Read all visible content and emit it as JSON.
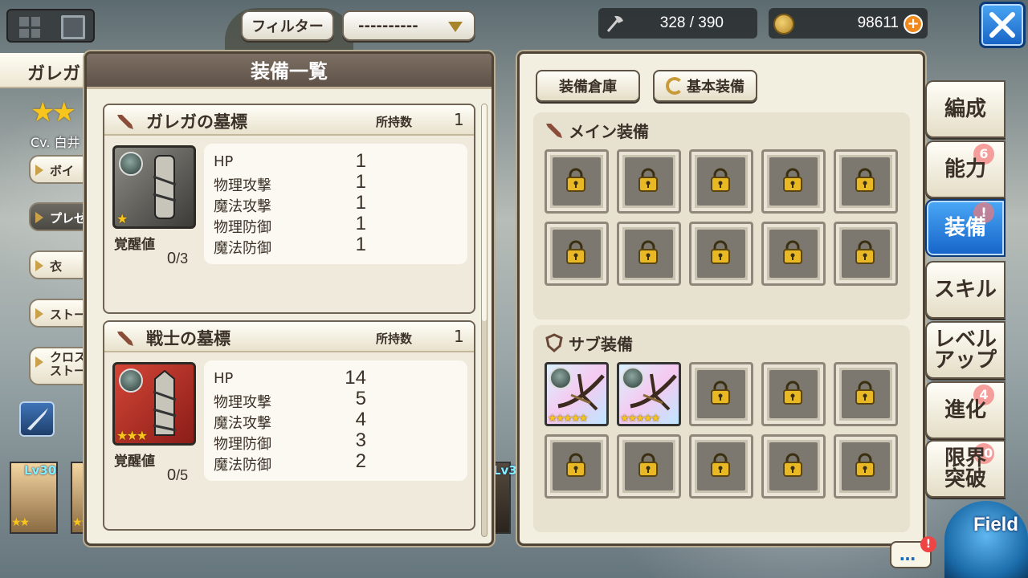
{
  "topbar": {
    "filter_label": "フィルター",
    "select_value": "----------",
    "stamina": "328 / 390",
    "currency": "98611"
  },
  "character": {
    "name": "ガレガ",
    "cv": "Cv. 白井",
    "tabs": [
      "ボイ",
      "プレゼ",
      "衣",
      "ストー",
      "クロス\nストー"
    ]
  },
  "party": [
    {
      "level": "Lv30",
      "stars": "★★"
    },
    {
      "level": "",
      "stars": "★★"
    }
  ],
  "party_right_level": "Lv3",
  "list_panel": {
    "title": "装備一覧",
    "own_label": "所持数",
    "awaken_label": "覚醒値",
    "items": [
      {
        "name": "ガレガの墓標",
        "owned": "1",
        "rarity": "★",
        "awaken_current": "0",
        "awaken_max": "/3",
        "stats": [
          {
            "label": "HP",
            "value": "1"
          },
          {
            "label": "物理攻撃",
            "value": "1"
          },
          {
            "label": "魔法攻撃",
            "value": "1"
          },
          {
            "label": "物理防御",
            "value": "1"
          },
          {
            "label": "魔法防御",
            "value": "1"
          }
        ]
      },
      {
        "name": "戦士の墓標",
        "owned": "1",
        "rarity": "★★★",
        "awaken_current": "0",
        "awaken_max": "/5",
        "stats": [
          {
            "label": "HP",
            "value": "14"
          },
          {
            "label": "物理攻撃",
            "value": "5"
          },
          {
            "label": "魔法攻撃",
            "value": "4"
          },
          {
            "label": "物理防御",
            "value": "3"
          },
          {
            "label": "魔法防御",
            "value": "2"
          }
        ]
      }
    ]
  },
  "equip_panel": {
    "warehouse_label": "装備倉庫",
    "basic_label": "基本装備",
    "main_title": "メイン装備",
    "sub_title": "サブ装備",
    "sub_filled_rarity": "★★★★★"
  },
  "right_tabs": [
    {
      "label": "編成",
      "badge": ""
    },
    {
      "label": "能力",
      "badge": "6"
    },
    {
      "label": "装備",
      "badge": "!"
    },
    {
      "label": "スキル",
      "badge": ""
    },
    {
      "label": "レベル\nアップ",
      "badge": ""
    },
    {
      "label": "進化",
      "badge": "4"
    },
    {
      "label": "限界\n突破",
      "badge": "30"
    }
  ],
  "field_label": "Field",
  "chat_dots": "…",
  "colors": {
    "accent_blue": "#1663c8",
    "panel_bg": "#f3efe0",
    "header_brown": "#5e5248",
    "star_gold": "#f8c51d",
    "badge_red": "#f27878"
  }
}
